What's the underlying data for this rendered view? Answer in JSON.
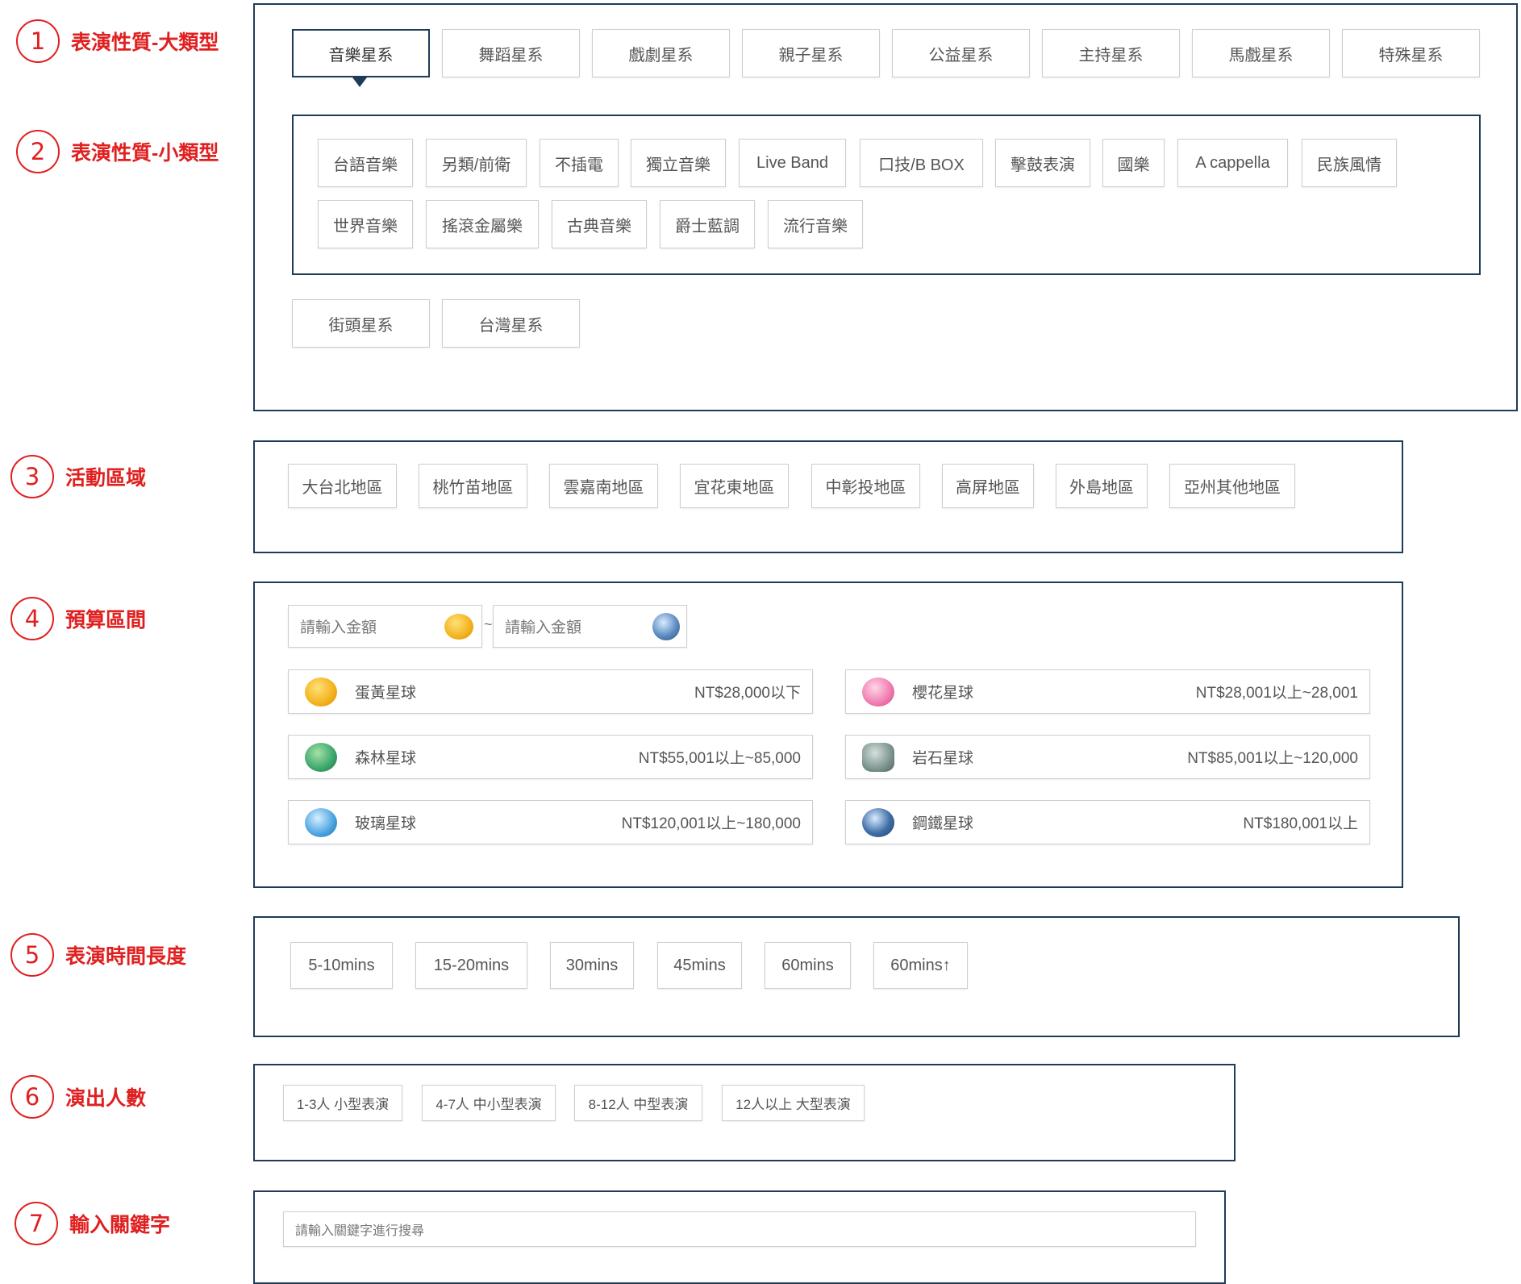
{
  "sections": [
    {
      "num": "1",
      "title": "表演性質-大類型"
    },
    {
      "num": "2",
      "title": "表演性質-小類型"
    },
    {
      "num": "3",
      "title": "活動區域"
    },
    {
      "num": "4",
      "title": "預算區間"
    },
    {
      "num": "5",
      "title": "表演時間長度"
    },
    {
      "num": "6",
      "title": "演出人數"
    },
    {
      "num": "7",
      "title": "輸入關鍵字"
    }
  ],
  "major_types": [
    "音樂星系",
    "舞蹈星系",
    "戲劇星系",
    "親子星系",
    "公益星系",
    "主持星系",
    "馬戲星系",
    "特殊星系",
    "街頭星系",
    "台灣星系"
  ],
  "active_major": "音樂星系",
  "minor_types": [
    "台語音樂",
    "另類/前衛",
    "不插電",
    "獨立音樂",
    "Live Band",
    "口技/B BOX",
    "擊鼓表演",
    "國樂",
    "A cappella",
    "民族風情",
    "世界音樂",
    "搖滾金屬樂",
    "古典音樂",
    "爵士藍調",
    "流行音樂"
  ],
  "regions": [
    "大台北地區",
    "桃竹苗地區",
    "雲嘉南地區",
    "宜花東地區",
    "中彰投地區",
    "高屏地區",
    "外島地區",
    "亞州其他地區"
  ],
  "budget": {
    "min_placeholder": "請輸入金額",
    "max_placeholder": "請輸入金額",
    "separator": "~",
    "options": [
      {
        "name": "蛋黃星球",
        "range": "NT$28,000以下",
        "icon": "egg-yolk-planet-icon",
        "color": "#f3b21c"
      },
      {
        "name": "櫻花星球",
        "range": "NT$28,001以上~28,001",
        "icon": "sakura-planet-icon",
        "color": "#f07ab0"
      },
      {
        "name": "森林星球",
        "range": "NT$55,001以上~85,000",
        "icon": "forest-planet-icon",
        "color": "#3aa66a"
      },
      {
        "name": "岩石星球",
        "range": "NT$85,001以上~120,000",
        "icon": "rock-planet-icon",
        "color": "#7d9590"
      },
      {
        "name": "玻璃星球",
        "range": "NT$120,001以上~180,000",
        "icon": "glass-planet-icon",
        "color": "#4aa3e0"
      },
      {
        "name": "鋼鐵星球",
        "range": "NT$180,001以上",
        "icon": "steel-planet-icon",
        "color": "#3f6ea6"
      }
    ]
  },
  "durations": [
    "5-10mins",
    "15-20mins",
    "30mins",
    "45mins",
    "60mins",
    "60mins↑"
  ],
  "performers": [
    "1-3人 小型表演",
    "4-7人 中小型表演",
    "8-12人 中型表演",
    "12人以上 大型表演"
  ],
  "keyword_placeholder": "請輸入關鍵字進行搜尋"
}
